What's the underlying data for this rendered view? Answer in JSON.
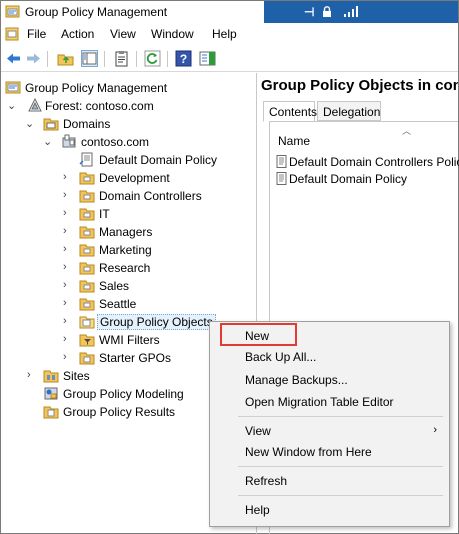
{
  "window": {
    "title": "Group Policy Management"
  },
  "connection_bar": {
    "pin_glyph": "⊣"
  },
  "menubar": {
    "items": [
      "File",
      "Action",
      "View",
      "Window",
      "Help"
    ]
  },
  "toolbar": {
    "buttons": [
      "back-icon",
      "forward-icon",
      "up-folder-icon",
      "show-hide-tree-icon",
      "properties-icon",
      "refresh-icon",
      "help-icon",
      "show-hide-action-pane-icon"
    ]
  },
  "tree": {
    "root": "Group Policy Management",
    "forest": "Forest: contoso.com",
    "domains": "Domains",
    "domain": "contoso.com",
    "children": [
      "Default Domain Policy",
      "Development",
      "Domain Controllers",
      "IT",
      "Managers",
      "Marketing",
      "Research",
      "Sales",
      "Seattle",
      "Group Policy Objects",
      "WMI Filters",
      "Starter GPOs"
    ],
    "sites": "Sites",
    "modeling": "Group Policy Modeling",
    "results": "Group Policy Results"
  },
  "right_pane": {
    "header": "Group Policy Objects in contoso.com",
    "tabs": [
      "Contents",
      "Delegation"
    ],
    "column_name": "Name",
    "rows": [
      "Default Domain Controllers Policy",
      "Default Domain Policy"
    ]
  },
  "context_menu": {
    "items": [
      {
        "label": "New"
      },
      {
        "label": "Back Up All..."
      },
      {
        "label": "Manage Backups..."
      },
      {
        "label": "Open Migration Table Editor"
      },
      {
        "label": "View",
        "submenu": "›"
      },
      {
        "label": "New Window from Here"
      },
      {
        "label": "Refresh"
      },
      {
        "label": "Help"
      }
    ],
    "highlighted": "New"
  },
  "colors": {
    "connection_bar": "#1f61a8",
    "highlight_box": "#e03c31",
    "menu_bg": "#f2f2f2"
  }
}
